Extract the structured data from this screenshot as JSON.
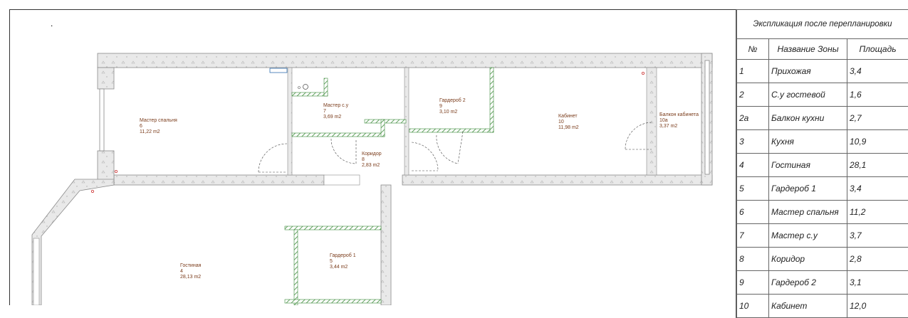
{
  "plan": {
    "corner_mark": ".",
    "rooms": [
      {
        "id": "master-bedroom",
        "name": "Мастер спальня",
        "number": "6",
        "area": "11,22 m2"
      },
      {
        "id": "master-bath",
        "name": "Мастер с.у",
        "number": "7",
        "area": "3,69 m2"
      },
      {
        "id": "wardrobe-2",
        "name": "Гардероб 2",
        "number": "9",
        "area": "3,10 m2"
      },
      {
        "id": "study",
        "name": "Кабинет",
        "number": "10",
        "area": "11,98 m2"
      },
      {
        "id": "study-balcony",
        "name": "Балкон кабинета",
        "number": "10a",
        "area": "3,37 m2"
      },
      {
        "id": "corridor",
        "name": "Коридор",
        "number": "8",
        "area": "2,83 m2"
      },
      {
        "id": "living-room",
        "name": "Гостиная",
        "number": "4",
        "area": "28,13 m2"
      },
      {
        "id": "wardrobe-1",
        "name": "Гардероб 1",
        "number": "5",
        "area": "3,44 m2"
      }
    ]
  },
  "explication": {
    "title": "Экспликация после перепланировки",
    "headers": {
      "no": "№",
      "name": "Название Зоны",
      "area": "Площадь"
    },
    "rows": [
      {
        "no": "1",
        "name": "Прихожая",
        "area": "3,4"
      },
      {
        "no": "2",
        "name": "С.у гостевой",
        "area": "1,6"
      },
      {
        "no": "2а",
        "name": "Балкон кухни",
        "area": "2,7"
      },
      {
        "no": "3",
        "name": "Кухня",
        "area": "10,9"
      },
      {
        "no": "4",
        "name": "Гостиная",
        "area": "28,1"
      },
      {
        "no": "5",
        "name": "Гардероб 1",
        "area": "3,4"
      },
      {
        "no": "6",
        "name": "Мастер спальня",
        "area": "11,2"
      },
      {
        "no": "7",
        "name": "Мастер с.у",
        "area": "3,7"
      },
      {
        "no": "8",
        "name": "Коридор",
        "area": "2,8"
      },
      {
        "no": "9",
        "name": "Гардероб 2",
        "area": "3,1"
      },
      {
        "no": "10",
        "name": "Кабинет",
        "area": "12,0"
      }
    ]
  }
}
